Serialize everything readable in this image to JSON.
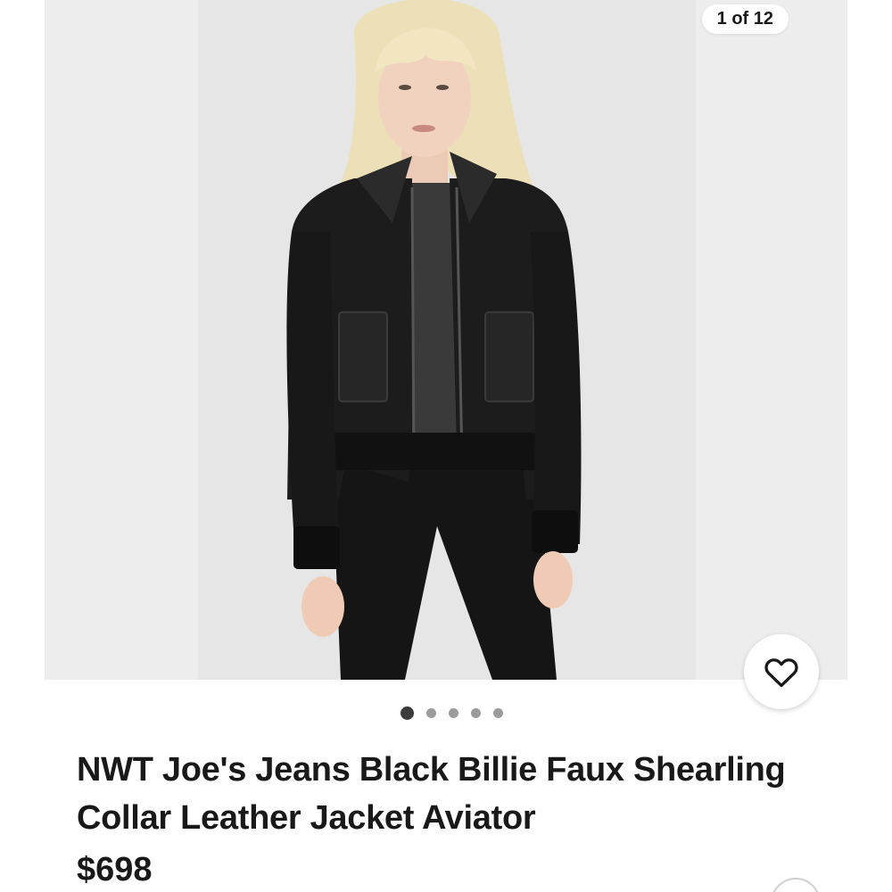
{
  "gallery": {
    "counter": "1 of 12",
    "image_alt": "Model wearing a black leather aviator jacket with shearling collar",
    "dots_total": 5,
    "dots_active": 0
  },
  "listing": {
    "title": "NWT Joe's Jeans Black Billie Faux Shearling Collar Leather Jacket Aviator",
    "price": "$698"
  },
  "icons": {
    "favorite": "heart-outline-icon"
  },
  "colors": {
    "text": "#191919",
    "dot_active": "#3c3c3c",
    "dot_inactive": "#9b9b9b"
  }
}
